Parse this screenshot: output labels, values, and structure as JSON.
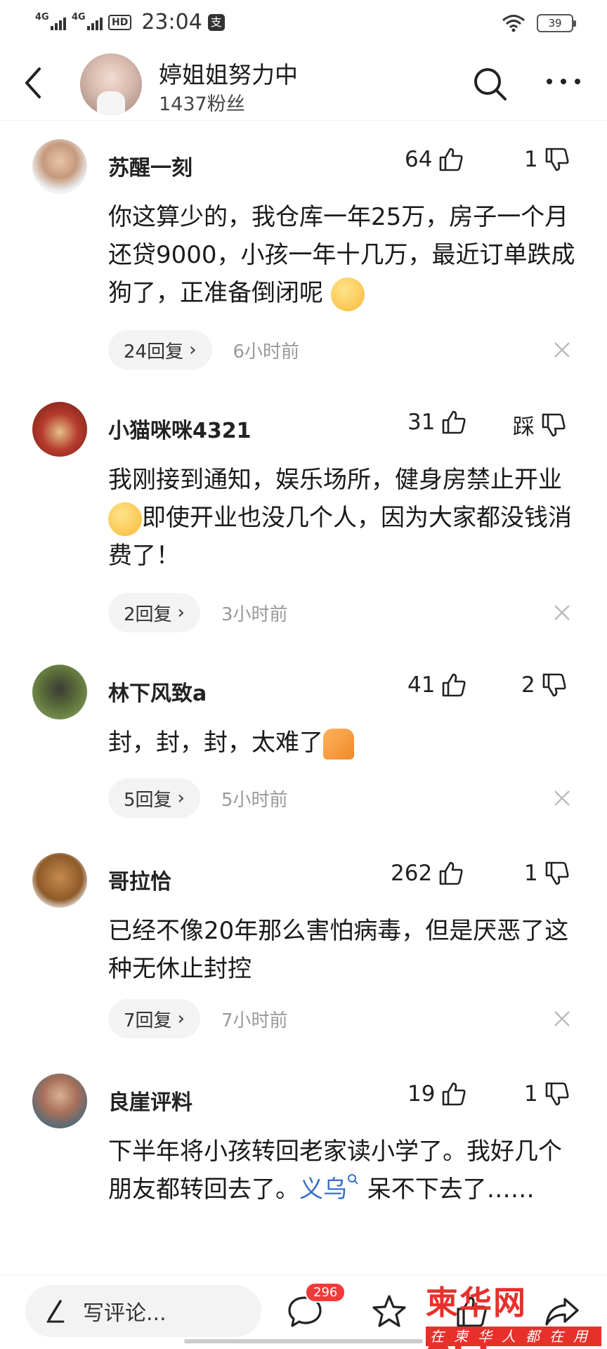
{
  "status_bar": {
    "time": "23:04",
    "net1": "4G",
    "net2": "4G",
    "hd": "HD",
    "pay_icon": "支",
    "battery": "39"
  },
  "header": {
    "name": "婷姐姐努力中",
    "fans": "1437粉丝"
  },
  "comments": [
    {
      "name": "苏醒一刻",
      "likes": "64",
      "dislikes": "1",
      "text": "你这算少的，我仓库一年25万，房子一个月还贷9000，小孩一年十几万，最近订单跌成狗了，正准备倒闭呢",
      "replies": "24回复",
      "time": "6小时前"
    },
    {
      "name": "小猫咪咪4321",
      "likes": "31",
      "dislikes": "踩",
      "text_a": "我刚接到通知，娱乐场所，健身房禁止开业",
      "text_b": "即使开业也没几个人，因为大家都没钱消费了！",
      "replies": "2回复",
      "time": "3小时前"
    },
    {
      "name": "林下风致a",
      "likes": "41",
      "dislikes": "2",
      "text": "封，封，封，太难了",
      "replies": "5回复",
      "time": "5小时前"
    },
    {
      "name": "哥拉恰",
      "likes": "262",
      "dislikes": "1",
      "text": "已经不像20年那么害怕病毒，但是厌恶了这种无休止封控",
      "replies": "7回复",
      "time": "7小时前"
    },
    {
      "name": "良崖评料",
      "likes": "19",
      "dislikes": "1",
      "text_a": "下半年将小孩转回老家读小学了。我好几个朋友都转回去了。",
      "link": "义乌",
      "text_b": " 呆不下去了……"
    }
  ],
  "bottom_bar": {
    "write_placeholder": "写评论...",
    "comment_count": "296"
  },
  "watermark": {
    "main": "柬华网APP",
    "sub": "在柬华人都在用"
  }
}
